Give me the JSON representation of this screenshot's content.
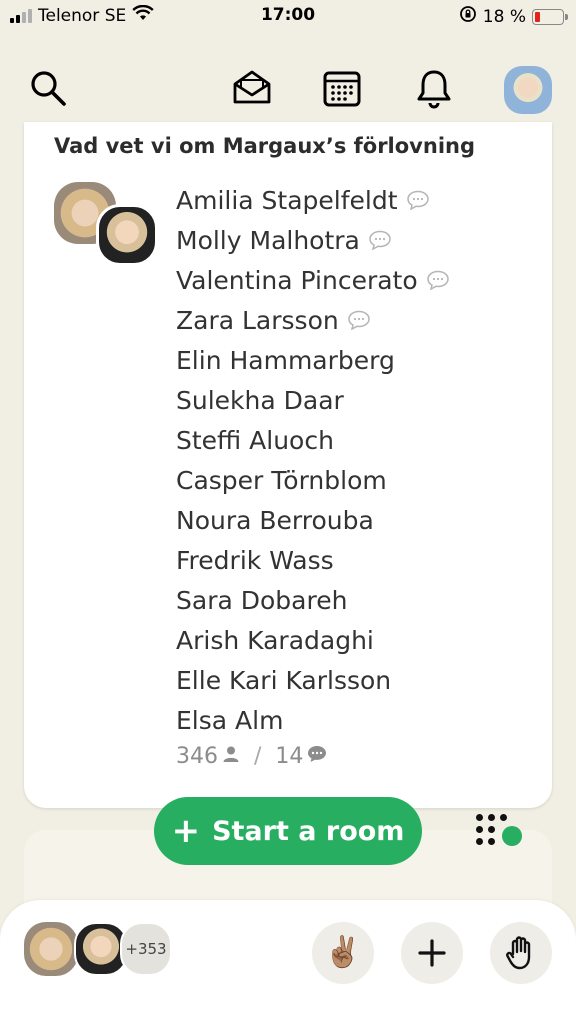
{
  "status_bar": {
    "carrier": "Telenor SE",
    "time": "17:00",
    "battery": "18 %",
    "battery_level": 0.18,
    "battery_color": "#e2231a"
  },
  "topnav": {
    "icons": [
      "search-icon",
      "mail-icon",
      "calendar-icon",
      "bell-icon",
      "avatar"
    ]
  },
  "room": {
    "title": "Vad vet vi om Margaux’s förlovning",
    "participants": [
      {
        "name": "Amilia Stapelfeldt",
        "chat": true
      },
      {
        "name": "Molly Malhotra",
        "chat": true
      },
      {
        "name": "Valentina Pincerato",
        "chat": true
      },
      {
        "name": "Zara Larsson",
        "chat": true
      },
      {
        "name": "Elin Hammarberg",
        "chat": false
      },
      {
        "name": "Sulekha Daar",
        "chat": false
      },
      {
        "name": "Steffi Aluoch",
        "chat": false
      },
      {
        "name": "Casper Törnblom",
        "chat": false
      },
      {
        "name": "Noura Berrouba",
        "chat": false
      },
      {
        "name": "Fredrik Wass",
        "chat": false
      },
      {
        "name": "Sara Dobareh",
        "chat": false
      },
      {
        "name": "Arish Karadaghi",
        "chat": false
      },
      {
        "name": "Elle Kari Karlsson",
        "chat": false
      },
      {
        "name": "Elsa Alm",
        "chat": false
      }
    ],
    "listener_count": "346",
    "separator": "/",
    "speaker_count": "14"
  },
  "start_room": {
    "label": "Start a room",
    "color": "#27ae60"
  },
  "bottom_bar": {
    "extra_count": "+353",
    "peace_emoji": "✌🏽"
  }
}
